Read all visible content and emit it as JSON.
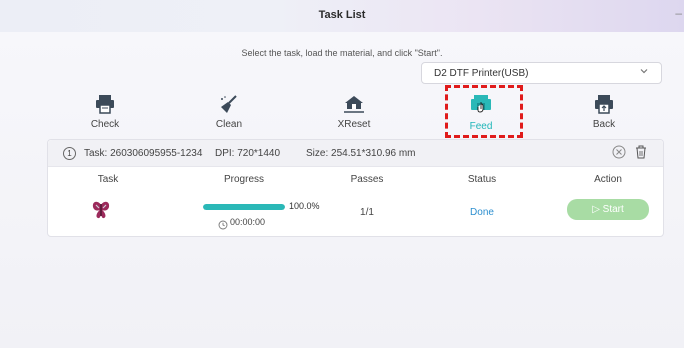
{
  "window": {
    "title": "Task List",
    "minimize_glyph": "–"
  },
  "instruction": "Select the task, load the material, and click \"Start\".",
  "printer_select": {
    "value": "D2 DTF Printer(USB)"
  },
  "toolbar": {
    "items": [
      {
        "label": "Check",
        "icon": "printer-check-icon"
      },
      {
        "label": "Clean",
        "icon": "broom-clean-icon"
      },
      {
        "label": "XReset",
        "icon": "home-reset-icon"
      },
      {
        "label": "Feed",
        "icon": "feed-printer-icon",
        "active": true
      },
      {
        "label": "Back",
        "icon": "back-printer-icon"
      }
    ]
  },
  "task": {
    "index": "1",
    "task_id": "Task: 260306095955-1234",
    "dpi": "DPI: 720*1440",
    "size": "Size: 254.51*310.96 mm",
    "columns": [
      "Task",
      "Progress",
      "Passes",
      "Status",
      "Action"
    ],
    "progress": {
      "fraction": 1.0,
      "percent_text": "100.0%",
      "elapsed": "00:00:00"
    },
    "passes": "1/1",
    "status": "Done",
    "action_label": "▷ Start"
  },
  "colors": {
    "accent": "#2ab8b7",
    "status_done": "#2d8fcf",
    "start_button": "#a8dca4",
    "highlight_box": "#e01b1b"
  }
}
